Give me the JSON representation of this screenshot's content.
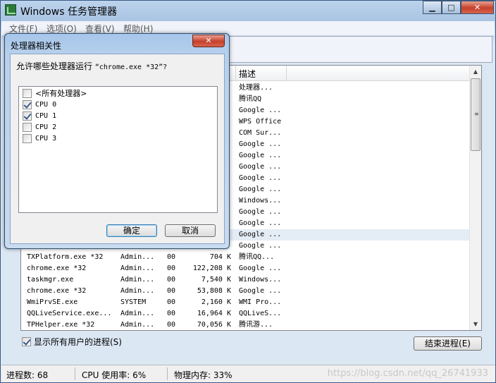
{
  "window": {
    "title": "Windows 任务管理器",
    "controls": {
      "minimize": "▁",
      "maximize": "□",
      "close": "✕"
    }
  },
  "menu": [
    "文件(F)",
    "选项(O)",
    "查看(V)",
    "帮助(H)"
  ],
  "process_list": {
    "headers": {
      "description": "描述"
    },
    "rows": [
      {
        "name": "",
        "user": "",
        "cpu": "",
        "mem": "",
        "desc": "处理器..."
      },
      {
        "name": "",
        "user": "",
        "cpu": "",
        "mem": "",
        "desc": "腾讯QQ"
      },
      {
        "name": "",
        "user": "",
        "cpu": "",
        "mem": "",
        "desc": "Google ..."
      },
      {
        "name": "",
        "user": "",
        "cpu": "",
        "mem": "",
        "desc": "WPS Office"
      },
      {
        "name": "",
        "user": "",
        "cpu": "",
        "mem": "",
        "desc": "COM Sur..."
      },
      {
        "name": "",
        "user": "",
        "cpu": "",
        "mem": "",
        "desc": "Google ..."
      },
      {
        "name": "",
        "user": "",
        "cpu": "",
        "mem": "",
        "desc": "Google ..."
      },
      {
        "name": "",
        "user": "",
        "cpu": "",
        "mem": "",
        "desc": "Google ..."
      },
      {
        "name": "",
        "user": "",
        "cpu": "",
        "mem": "",
        "desc": "Google ..."
      },
      {
        "name": "",
        "user": "",
        "cpu": "",
        "mem": "",
        "desc": "Google ..."
      },
      {
        "name": "",
        "user": "",
        "cpu": "",
        "mem": "",
        "desc": "Windows..."
      },
      {
        "name": "",
        "user": "",
        "cpu": "",
        "mem": "",
        "desc": "Google ..."
      },
      {
        "name": "",
        "user": "",
        "cpu": "",
        "mem": "",
        "desc": "Google ..."
      },
      {
        "name": "",
        "user": "",
        "cpu": "",
        "mem": "",
        "desc": "Google ...",
        "selected": true
      },
      {
        "name": "",
        "user": "",
        "cpu": "",
        "mem": "",
        "desc": "Google ..."
      },
      {
        "name": "TXPlatform.exe *32",
        "user": "Admin...",
        "cpu": "00",
        "mem": "704 K",
        "desc": "腾讯QQ..."
      },
      {
        "name": "chrome.exe *32",
        "user": "Admin...",
        "cpu": "00",
        "mem": "122,208 K",
        "desc": "Google ..."
      },
      {
        "name": "taskmgr.exe",
        "user": "Admin...",
        "cpu": "00",
        "mem": "7,540 K",
        "desc": "Windows..."
      },
      {
        "name": "chrome.exe *32",
        "user": "Admin...",
        "cpu": "00",
        "mem": "53,808 K",
        "desc": "Google ..."
      },
      {
        "name": "WmiPrvSE.exe",
        "user": "SYSTEM",
        "cpu": "00",
        "mem": "2,160 K",
        "desc": "WMI Pro..."
      },
      {
        "name": "QQLiveService.exe...",
        "user": "Admin...",
        "cpu": "00",
        "mem": "16,964 K",
        "desc": "QQLiveS..."
      },
      {
        "name": "TPHelper.exe *32",
        "user": "Admin...",
        "cpu": "00",
        "mem": "70,056 K",
        "desc": "腾讯游..."
      }
    ]
  },
  "show_all_users": {
    "label": "显示所有用户的进程(S)",
    "checked": true
  },
  "end_process_button": "结束进程(E)",
  "status": {
    "processes": "进程数: 68",
    "cpu": "CPU 使用率: 6%",
    "memory": "物理内存: 33%"
  },
  "watermark": "https://blog.csdn.net/qq_26741933",
  "dialog": {
    "title": "处理器相关性",
    "close": "✕",
    "prompt_prefix": "允许哪些处理器运行",
    "prompt_target": "“chrome.exe *32”?",
    "options": [
      {
        "label": "<所有处理器>",
        "checked": false
      },
      {
        "label": "CPU 0",
        "checked": true
      },
      {
        "label": "CPU 1",
        "checked": true
      },
      {
        "label": "CPU 2",
        "checked": false
      },
      {
        "label": "CPU 3",
        "checked": false
      }
    ],
    "ok": "确定",
    "cancel": "取消"
  }
}
